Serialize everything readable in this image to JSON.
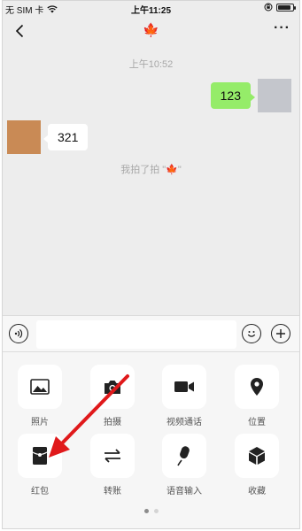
{
  "status_bar": {
    "carrier": "无 SIM 卡",
    "time": "上午11:25"
  },
  "nav": {
    "title_emoji": "🍁",
    "more_label": "···"
  },
  "chat": {
    "time_label": "上午10:52",
    "messages": [
      {
        "side": "right",
        "text": "123"
      },
      {
        "side": "left",
        "text": "321"
      }
    ],
    "system_tip": "我拍了拍 \"🍁\""
  },
  "panel": {
    "items": [
      {
        "label": "照片",
        "icon": "photo-icon"
      },
      {
        "label": "拍摄",
        "icon": "camera-icon"
      },
      {
        "label": "视频通话",
        "icon": "video-call-icon"
      },
      {
        "label": "位置",
        "icon": "location-icon"
      },
      {
        "label": "红包",
        "icon": "red-packet-icon"
      },
      {
        "label": "转账",
        "icon": "transfer-icon"
      },
      {
        "label": "语音输入",
        "icon": "microphone-icon"
      },
      {
        "label": "收藏",
        "icon": "favorites-icon"
      }
    ],
    "pages": 2,
    "active_page": 1
  },
  "colors": {
    "chat_bg": "#ededed",
    "my_bubble": "#95ec69",
    "annotation_arrow": "#e0191b"
  }
}
